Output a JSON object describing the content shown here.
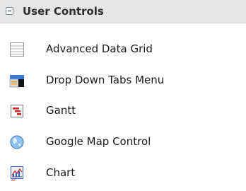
{
  "header": {
    "title": "User Controls"
  },
  "items": [
    {
      "label": "Advanced Data Grid",
      "icon": "grid-icon"
    },
    {
      "label": "Drop Down Tabs Menu",
      "icon": "tabs-menu-icon"
    },
    {
      "label": "Gantt",
      "icon": "gantt-icon"
    },
    {
      "label": "Google Map Control",
      "icon": "globe-icon"
    },
    {
      "label": "Chart",
      "icon": "chart-icon"
    }
  ]
}
